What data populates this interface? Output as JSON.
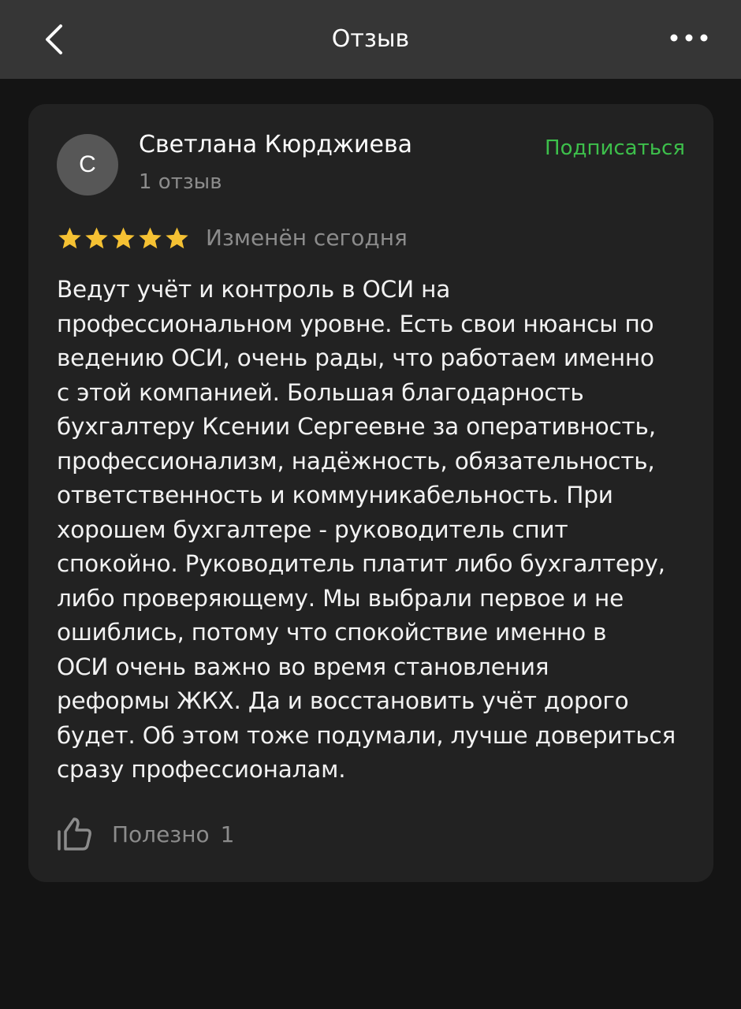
{
  "header": {
    "title": "Отзыв",
    "back_icon": "chevron-left-icon",
    "more_icon": "more-horizontal-icon"
  },
  "review": {
    "author": {
      "initial": "С",
      "name": "Светлана Кюрджиева",
      "reviews_count": "1 отзыв"
    },
    "subscribe_label": "Подписаться",
    "rating": 5,
    "rating_max": 5,
    "edited": "Изменён сегодня",
    "text": "Ведут учёт и контроль в ОСИ на\nпрофессиональном уровне. Есть свои нюансы по\nведению ОСИ, очень рады, что работаем именно\nс этой компанией. Большая благодарность\nбухгалтеру Ксении Сергеевне за оперативность,\nпрофессионализм, надёжность, обязательность,\nответственность и коммуникабельность. При\nхорошем бухгалтере - руководитель спит\nспокойно. Руководитель платит либо бухгалтеру,\nлибо проверяющему. Мы выбрали первое и не\nошиблись, потому что спокойствие именно в\nОСИ очень важно во время становления\nреформы ЖКХ. Да и восстановить учёт дорого\nбудет. Об этом тоже подумали, лучше довериться\nсразу профессионалам.",
    "useful_label": "Полезно",
    "useful_count": "1"
  },
  "colors": {
    "background": "#141414",
    "header_bg": "#363636",
    "card_bg": "#222222",
    "accent_green": "#3dbf4b",
    "star": "#f5c133",
    "muted_text": "#8c8c8c"
  }
}
